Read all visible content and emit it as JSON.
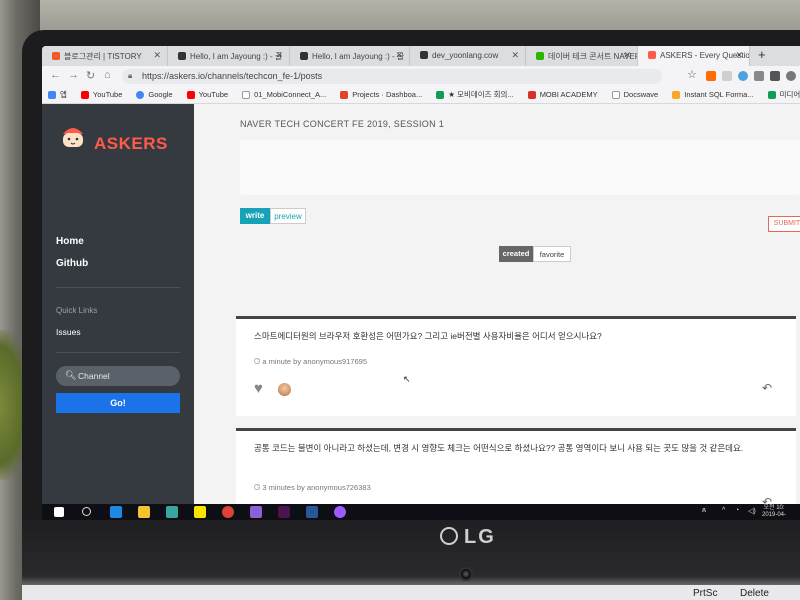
{
  "browser": {
    "tabs": [
      {
        "label": "블로그관리 | TISTORY",
        "color": "#f15a24"
      },
      {
        "label": "Hello, I am Jayoung :) - 글",
        "color": "#333333"
      },
      {
        "label": "Hello, I am Jayoung :) - 글",
        "color": "#333333"
      },
      {
        "label": "dev_yoonlang.cow",
        "color": "#333333"
      },
      {
        "label": "데이버 테크 콘서트 NAVER",
        "color": "#2db400"
      },
      {
        "label": "ASKERS - Every Question S",
        "color": "#ff5a4a"
      }
    ],
    "url": "https://askers.io/channels/techcon_fe-1/posts",
    "bookmarks": [
      {
        "label": "앱",
        "color": "#4285f4"
      },
      {
        "label": "YouTube",
        "color": "#ff0000"
      },
      {
        "label": "Google",
        "color": "#4285f4"
      },
      {
        "label": "YouTube",
        "color": "#ff0000"
      },
      {
        "label": "01_MobiConnect_A...",
        "color": "#999999"
      },
      {
        "label": "Projects · Dashboa...",
        "color": "#e24329"
      },
      {
        "label": "★ 모비데이즈 회의...",
        "color": "#0f9d58"
      },
      {
        "label": "MOBI ACADEMY",
        "color": "#d93025"
      },
      {
        "label": "Docswave",
        "color": "#999999"
      },
      {
        "label": "Instant SQL Forma...",
        "color": "#f9a825"
      },
      {
        "label": "미디어솔루션 업무...",
        "color": "#0f9d58"
      }
    ]
  },
  "sidebar": {
    "brand": "ASKERS",
    "nav": [
      {
        "label": "Home"
      },
      {
        "label": "Github"
      }
    ],
    "quick_links_title": "Quick Links",
    "issues_label": "Issues",
    "channel_placeholder": "Channel",
    "go_label": "Go!"
  },
  "main": {
    "title": "NAVER TECH CONCERT FE 2019, SESSION 1",
    "editor_tabs": {
      "write": "write",
      "preview": "preview"
    },
    "submit_label": "SUBMIT",
    "sort": {
      "created": "created",
      "favorite": "favorite"
    },
    "questions": [
      {
        "text": "스마트에디터원의 브라우저 호환성은 어떤가요? 그리고 ie버전별 사용자비율은 어디서 얻으시나요?",
        "meta": "a minute by anonymous917695"
      },
      {
        "text": "공통 코드는 불변이 아니라고 하셨는데, 변경 시 영향도 체크는 어떤식으로 하셨나요?? 공통 영역이다 보니 사용 되는 곳도 많을 것 같은데요.",
        "meta": "3 minutes by anonymous726383"
      }
    ]
  },
  "taskbar": {
    "clock_line1": "오전 10:",
    "clock_line2": "2019-04-"
  },
  "keyboard": {
    "prtsc": "PrtSc",
    "delete": "Delete"
  },
  "logo": "LG"
}
